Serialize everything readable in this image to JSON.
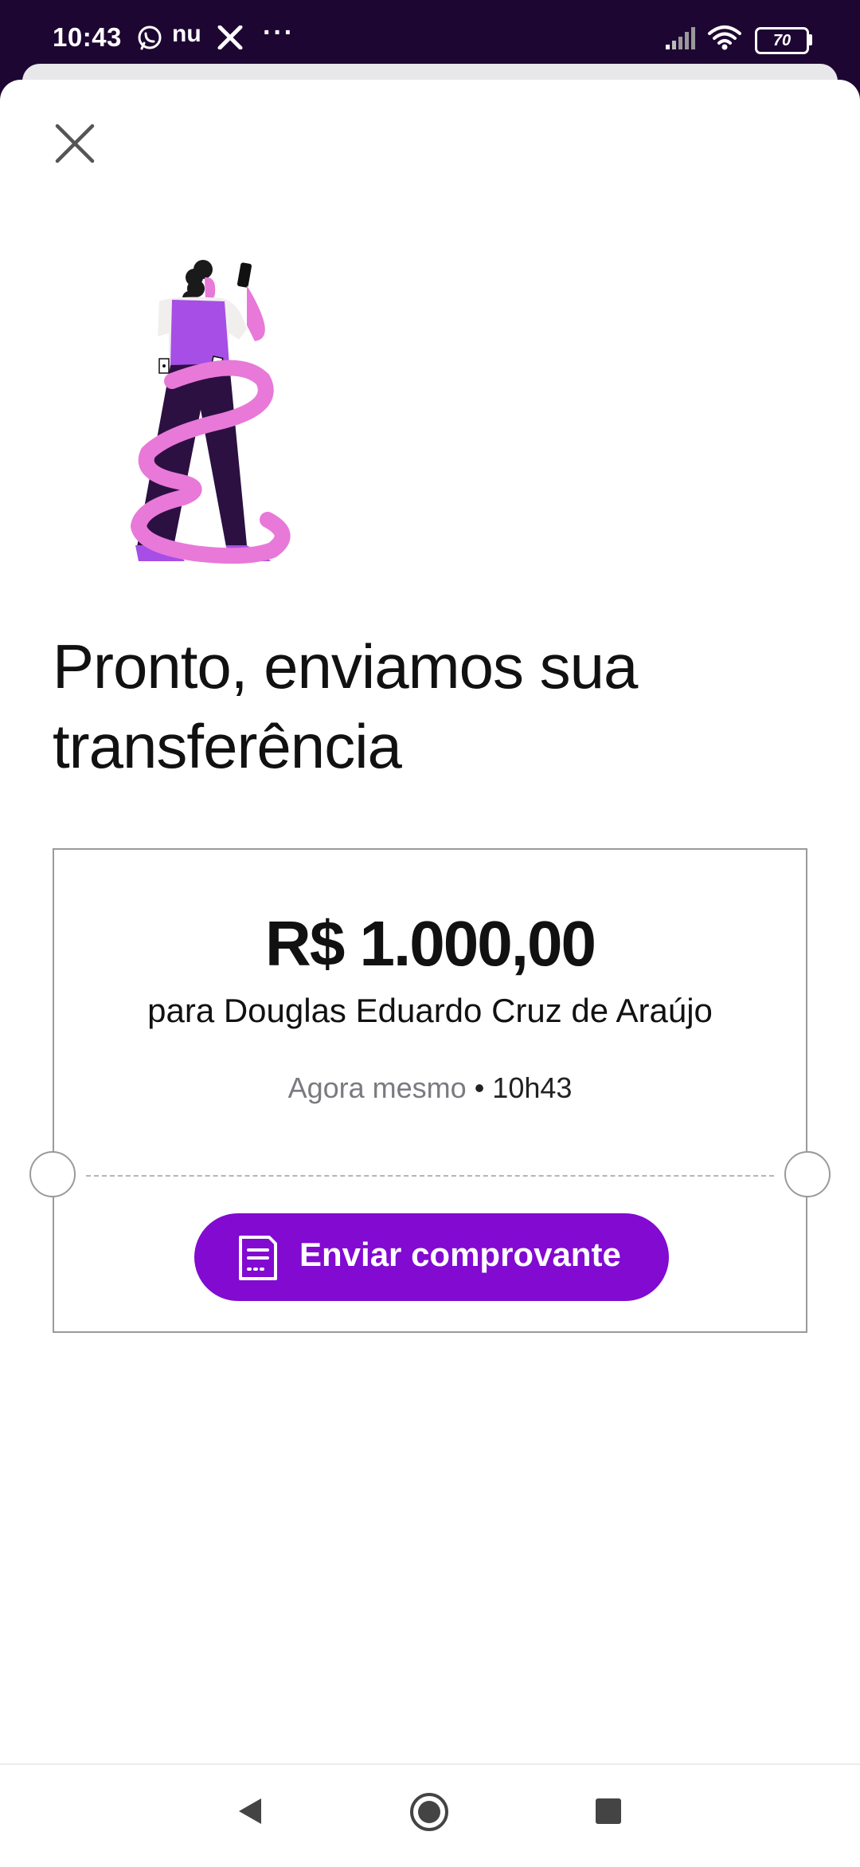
{
  "status_bar": {
    "time": "10:43",
    "nu_label": "nu",
    "more_label": "···",
    "battery": "70",
    "icons": [
      "whatsapp-icon",
      "nubank-icon",
      "x-icon",
      "signal-icon",
      "wifi-icon",
      "battery-icon"
    ]
  },
  "header": {
    "close_icon": "close-icon"
  },
  "main": {
    "title": "Pronto, enviamos sua transferência"
  },
  "receipt": {
    "amount": "R$ 1.000,00",
    "recipient": "para Douglas Eduardo Cruz de Araújo",
    "when": "Agora mesmo",
    "separator": " • ",
    "time": "10h43",
    "button_label": "Enviar comprovante",
    "button_icon": "receipt-icon"
  },
  "nav": {
    "icons": [
      "back-icon",
      "home-icon",
      "recents-icon"
    ]
  },
  "colors": {
    "accent": "#820ad1",
    "status_bar_bg": "#1e0633",
    "pink": "#e879d8",
    "dark_purple": "#2c1042",
    "purple": "#a64ee6"
  }
}
